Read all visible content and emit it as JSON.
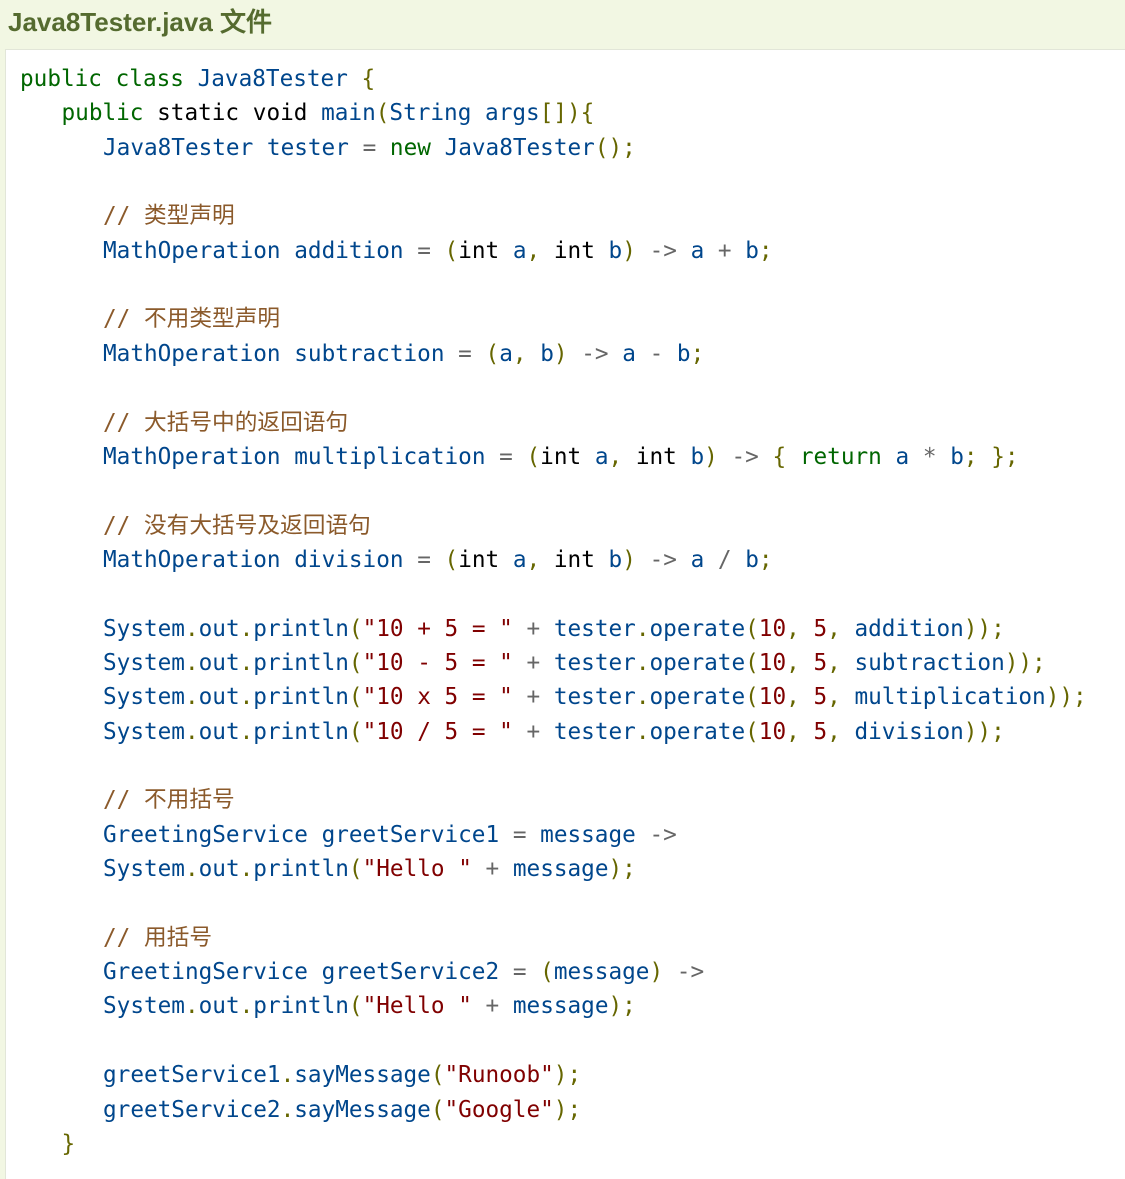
{
  "header": {
    "title": "Java8Tester.java 文件"
  },
  "code": {
    "lines": [
      {
        "indent": 0,
        "tokens": [
          [
            "kw",
            "public"
          ],
          [
            "pl",
            " "
          ],
          [
            "kw",
            "class"
          ],
          [
            "pl",
            " "
          ],
          [
            "id",
            "Java8Tester"
          ],
          [
            "pl",
            " "
          ],
          [
            "pun",
            "{"
          ]
        ]
      },
      {
        "indent": 1,
        "tokens": [
          [
            "kw",
            "public"
          ],
          [
            "pl",
            " "
          ],
          [
            "pl",
            "static"
          ],
          [
            "pl",
            " "
          ],
          [
            "pl",
            "void"
          ],
          [
            "pl",
            " "
          ],
          [
            "id",
            "main"
          ],
          [
            "pun",
            "("
          ],
          [
            "id",
            "String"
          ],
          [
            "pl",
            " "
          ],
          [
            "id",
            "args"
          ],
          [
            "pun",
            "[]){"
          ]
        ]
      },
      {
        "indent": 2,
        "tokens": [
          [
            "id",
            "Java8Tester"
          ],
          [
            "pl",
            " "
          ],
          [
            "id",
            "tester"
          ],
          [
            "pl",
            " "
          ],
          [
            "op",
            "="
          ],
          [
            "pl",
            " "
          ],
          [
            "kw",
            "new"
          ],
          [
            "pl",
            " "
          ],
          [
            "id",
            "Java8Tester"
          ],
          [
            "pun",
            "();"
          ]
        ]
      },
      {
        "indent": 0,
        "tokens": []
      },
      {
        "indent": 2,
        "tokens": [
          [
            "com",
            "// 类型声明"
          ]
        ]
      },
      {
        "indent": 2,
        "tokens": [
          [
            "id",
            "MathOperation"
          ],
          [
            "pl",
            " "
          ],
          [
            "id",
            "addition"
          ],
          [
            "pl",
            " "
          ],
          [
            "op",
            "="
          ],
          [
            "pl",
            " "
          ],
          [
            "pun",
            "("
          ],
          [
            "pl",
            "int"
          ],
          [
            "pl",
            " "
          ],
          [
            "id",
            "a"
          ],
          [
            "pun",
            ","
          ],
          [
            "pl",
            " "
          ],
          [
            "pl",
            "int"
          ],
          [
            "pl",
            " "
          ],
          [
            "id",
            "b"
          ],
          [
            "pun",
            ")"
          ],
          [
            "pl",
            " "
          ],
          [
            "op",
            "->"
          ],
          [
            "pl",
            " "
          ],
          [
            "id",
            "a"
          ],
          [
            "pl",
            " "
          ],
          [
            "op",
            "+"
          ],
          [
            "pl",
            " "
          ],
          [
            "id",
            "b"
          ],
          [
            "pun",
            ";"
          ]
        ]
      },
      {
        "indent": 0,
        "tokens": []
      },
      {
        "indent": 2,
        "tokens": [
          [
            "com",
            "// 不用类型声明"
          ]
        ]
      },
      {
        "indent": 2,
        "tokens": [
          [
            "id",
            "MathOperation"
          ],
          [
            "pl",
            " "
          ],
          [
            "id",
            "subtraction"
          ],
          [
            "pl",
            " "
          ],
          [
            "op",
            "="
          ],
          [
            "pl",
            " "
          ],
          [
            "pun",
            "("
          ],
          [
            "id",
            "a"
          ],
          [
            "pun",
            ","
          ],
          [
            "pl",
            " "
          ],
          [
            "id",
            "b"
          ],
          [
            "pun",
            ")"
          ],
          [
            "pl",
            " "
          ],
          [
            "op",
            "->"
          ],
          [
            "pl",
            " "
          ],
          [
            "id",
            "a"
          ],
          [
            "pl",
            " "
          ],
          [
            "op",
            "-"
          ],
          [
            "pl",
            " "
          ],
          [
            "id",
            "b"
          ],
          [
            "pun",
            ";"
          ]
        ]
      },
      {
        "indent": 0,
        "tokens": []
      },
      {
        "indent": 2,
        "tokens": [
          [
            "com",
            "// 大括号中的返回语句"
          ]
        ]
      },
      {
        "indent": 2,
        "tokens": [
          [
            "id",
            "MathOperation"
          ],
          [
            "pl",
            " "
          ],
          [
            "id",
            "multiplication"
          ],
          [
            "pl",
            " "
          ],
          [
            "op",
            "="
          ],
          [
            "pl",
            " "
          ],
          [
            "pun",
            "("
          ],
          [
            "pl",
            "int"
          ],
          [
            "pl",
            " "
          ],
          [
            "id",
            "a"
          ],
          [
            "pun",
            ","
          ],
          [
            "pl",
            " "
          ],
          [
            "pl",
            "int"
          ],
          [
            "pl",
            " "
          ],
          [
            "id",
            "b"
          ],
          [
            "pun",
            ")"
          ],
          [
            "pl",
            " "
          ],
          [
            "op",
            "->"
          ],
          [
            "pl",
            " "
          ],
          [
            "pun",
            "{"
          ],
          [
            "pl",
            " "
          ],
          [
            "kw",
            "return"
          ],
          [
            "pl",
            " "
          ],
          [
            "id",
            "a"
          ],
          [
            "pl",
            " "
          ],
          [
            "op",
            "*"
          ],
          [
            "pl",
            " "
          ],
          [
            "id",
            "b"
          ],
          [
            "pun",
            ";"
          ],
          [
            "pl",
            " "
          ],
          [
            "pun",
            "};"
          ]
        ]
      },
      {
        "indent": 0,
        "tokens": []
      },
      {
        "indent": 2,
        "tokens": [
          [
            "com",
            "// 没有大括号及返回语句"
          ]
        ]
      },
      {
        "indent": 2,
        "tokens": [
          [
            "id",
            "MathOperation"
          ],
          [
            "pl",
            " "
          ],
          [
            "id",
            "division"
          ],
          [
            "pl",
            " "
          ],
          [
            "op",
            "="
          ],
          [
            "pl",
            " "
          ],
          [
            "pun",
            "("
          ],
          [
            "pl",
            "int"
          ],
          [
            "pl",
            " "
          ],
          [
            "id",
            "a"
          ],
          [
            "pun",
            ","
          ],
          [
            "pl",
            " "
          ],
          [
            "pl",
            "int"
          ],
          [
            "pl",
            " "
          ],
          [
            "id",
            "b"
          ],
          [
            "pun",
            ")"
          ],
          [
            "pl",
            " "
          ],
          [
            "op",
            "->"
          ],
          [
            "pl",
            " "
          ],
          [
            "id",
            "a"
          ],
          [
            "pl",
            " "
          ],
          [
            "op",
            "/"
          ],
          [
            "pl",
            " "
          ],
          [
            "id",
            "b"
          ],
          [
            "pun",
            ";"
          ]
        ]
      },
      {
        "indent": 0,
        "tokens": []
      },
      {
        "indent": 2,
        "tokens": [
          [
            "id",
            "System"
          ],
          [
            "pun",
            "."
          ],
          [
            "id",
            "out"
          ],
          [
            "pun",
            "."
          ],
          [
            "id",
            "println"
          ],
          [
            "pun",
            "("
          ],
          [
            "str",
            "\"10 + 5 = \""
          ],
          [
            "pl",
            " "
          ],
          [
            "op",
            "+"
          ],
          [
            "pl",
            " "
          ],
          [
            "id",
            "tester"
          ],
          [
            "pun",
            "."
          ],
          [
            "id",
            "operate"
          ],
          [
            "pun",
            "("
          ],
          [
            "num",
            "10"
          ],
          [
            "pun",
            ","
          ],
          [
            "pl",
            " "
          ],
          [
            "num",
            "5"
          ],
          [
            "pun",
            ","
          ],
          [
            "pl",
            " "
          ],
          [
            "id",
            "addition"
          ],
          [
            "pun",
            "));"
          ]
        ]
      },
      {
        "indent": 2,
        "tokens": [
          [
            "id",
            "System"
          ],
          [
            "pun",
            "."
          ],
          [
            "id",
            "out"
          ],
          [
            "pun",
            "."
          ],
          [
            "id",
            "println"
          ],
          [
            "pun",
            "("
          ],
          [
            "str",
            "\"10 - 5 = \""
          ],
          [
            "pl",
            " "
          ],
          [
            "op",
            "+"
          ],
          [
            "pl",
            " "
          ],
          [
            "id",
            "tester"
          ],
          [
            "pun",
            "."
          ],
          [
            "id",
            "operate"
          ],
          [
            "pun",
            "("
          ],
          [
            "num",
            "10"
          ],
          [
            "pun",
            ","
          ],
          [
            "pl",
            " "
          ],
          [
            "num",
            "5"
          ],
          [
            "pun",
            ","
          ],
          [
            "pl",
            " "
          ],
          [
            "id",
            "subtraction"
          ],
          [
            "pun",
            "));"
          ]
        ]
      },
      {
        "indent": 2,
        "tokens": [
          [
            "id",
            "System"
          ],
          [
            "pun",
            "."
          ],
          [
            "id",
            "out"
          ],
          [
            "pun",
            "."
          ],
          [
            "id",
            "println"
          ],
          [
            "pun",
            "("
          ],
          [
            "str",
            "\"10 x 5 = \""
          ],
          [
            "pl",
            " "
          ],
          [
            "op",
            "+"
          ],
          [
            "pl",
            " "
          ],
          [
            "id",
            "tester"
          ],
          [
            "pun",
            "."
          ],
          [
            "id",
            "operate"
          ],
          [
            "pun",
            "("
          ],
          [
            "num",
            "10"
          ],
          [
            "pun",
            ","
          ],
          [
            "pl",
            " "
          ],
          [
            "num",
            "5"
          ],
          [
            "pun",
            ","
          ],
          [
            "pl",
            " "
          ],
          [
            "id",
            "multiplication"
          ],
          [
            "pun",
            "));"
          ]
        ]
      },
      {
        "indent": 2,
        "tokens": [
          [
            "id",
            "System"
          ],
          [
            "pun",
            "."
          ],
          [
            "id",
            "out"
          ],
          [
            "pun",
            "."
          ],
          [
            "id",
            "println"
          ],
          [
            "pun",
            "("
          ],
          [
            "str",
            "\"10 / 5 = \""
          ],
          [
            "pl",
            " "
          ],
          [
            "op",
            "+"
          ],
          [
            "pl",
            " "
          ],
          [
            "id",
            "tester"
          ],
          [
            "pun",
            "."
          ],
          [
            "id",
            "operate"
          ],
          [
            "pun",
            "("
          ],
          [
            "num",
            "10"
          ],
          [
            "pun",
            ","
          ],
          [
            "pl",
            " "
          ],
          [
            "num",
            "5"
          ],
          [
            "pun",
            ","
          ],
          [
            "pl",
            " "
          ],
          [
            "id",
            "division"
          ],
          [
            "pun",
            "));"
          ]
        ]
      },
      {
        "indent": 0,
        "tokens": []
      },
      {
        "indent": 2,
        "tokens": [
          [
            "com",
            "// 不用括号"
          ]
        ]
      },
      {
        "indent": 2,
        "tokens": [
          [
            "id",
            "GreetingService"
          ],
          [
            "pl",
            " "
          ],
          [
            "id",
            "greetService1"
          ],
          [
            "pl",
            " "
          ],
          [
            "op",
            "="
          ],
          [
            "pl",
            " "
          ],
          [
            "id",
            "message"
          ],
          [
            "pl",
            " "
          ],
          [
            "op",
            "->"
          ]
        ]
      },
      {
        "indent": 2,
        "tokens": [
          [
            "id",
            "System"
          ],
          [
            "pun",
            "."
          ],
          [
            "id",
            "out"
          ],
          [
            "pun",
            "."
          ],
          [
            "id",
            "println"
          ],
          [
            "pun",
            "("
          ],
          [
            "str",
            "\"Hello \""
          ],
          [
            "pl",
            " "
          ],
          [
            "op",
            "+"
          ],
          [
            "pl",
            " "
          ],
          [
            "id",
            "message"
          ],
          [
            "pun",
            ");"
          ]
        ]
      },
      {
        "indent": 0,
        "tokens": []
      },
      {
        "indent": 2,
        "tokens": [
          [
            "com",
            "// 用括号"
          ]
        ]
      },
      {
        "indent": 2,
        "tokens": [
          [
            "id",
            "GreetingService"
          ],
          [
            "pl",
            " "
          ],
          [
            "id",
            "greetService2"
          ],
          [
            "pl",
            " "
          ],
          [
            "op",
            "="
          ],
          [
            "pl",
            " "
          ],
          [
            "pun",
            "("
          ],
          [
            "id",
            "message"
          ],
          [
            "pun",
            ")"
          ],
          [
            "pl",
            " "
          ],
          [
            "op",
            "->"
          ]
        ]
      },
      {
        "indent": 2,
        "tokens": [
          [
            "id",
            "System"
          ],
          [
            "pun",
            "."
          ],
          [
            "id",
            "out"
          ],
          [
            "pun",
            "."
          ],
          [
            "id",
            "println"
          ],
          [
            "pun",
            "("
          ],
          [
            "str",
            "\"Hello \""
          ],
          [
            "pl",
            " "
          ],
          [
            "op",
            "+"
          ],
          [
            "pl",
            " "
          ],
          [
            "id",
            "message"
          ],
          [
            "pun",
            ");"
          ]
        ]
      },
      {
        "indent": 0,
        "tokens": []
      },
      {
        "indent": 2,
        "tokens": [
          [
            "id",
            "greetService1"
          ],
          [
            "pun",
            "."
          ],
          [
            "id",
            "sayMessage"
          ],
          [
            "pun",
            "("
          ],
          [
            "str",
            "\"Runoob\""
          ],
          [
            "pun",
            ");"
          ]
        ]
      },
      {
        "indent": 2,
        "tokens": [
          [
            "id",
            "greetService2"
          ],
          [
            "pun",
            "."
          ],
          [
            "id",
            "sayMessage"
          ],
          [
            "pun",
            "("
          ],
          [
            "str",
            "\"Google\""
          ],
          [
            "pun",
            ");"
          ]
        ]
      },
      {
        "indent": 1,
        "tokens": [
          [
            "pun",
            "}"
          ]
        ]
      }
    ]
  }
}
